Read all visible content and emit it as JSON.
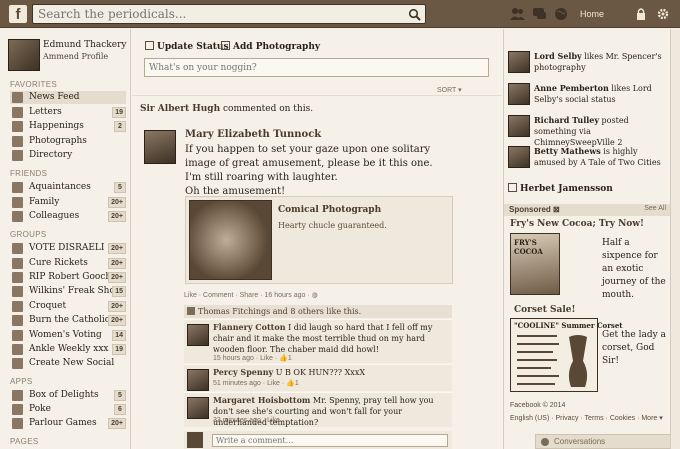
{
  "top": {
    "search_placeholder": "Search the periodicals...",
    "home": "Home"
  },
  "profile": {
    "name": "Edmund Thackery",
    "edit": "Ammend Profile"
  },
  "nav": {
    "favorites_label": "FAVORITES",
    "favorites": [
      {
        "label": "News Feed",
        "count": ""
      },
      {
        "label": "Letters",
        "count": "19"
      },
      {
        "label": "Happenings",
        "count": "2"
      },
      {
        "label": "Photographs",
        "count": ""
      },
      {
        "label": "Directory",
        "count": ""
      }
    ],
    "friends_label": "FRIENDS",
    "friends": [
      {
        "label": "Aquaintances",
        "count": "5"
      },
      {
        "label": "Family",
        "count": "20+"
      },
      {
        "label": "Colleagues",
        "count": "20+"
      }
    ],
    "groups_label": "GROUPS",
    "groups": [
      {
        "label": "VOTE DISRAELI",
        "count": "20+"
      },
      {
        "label": "Cure Rickets",
        "count": "20+"
      },
      {
        "label": "RIP Robert Gooch",
        "count": "20+"
      },
      {
        "label": "Wilkins' Freak Show",
        "count": "15"
      },
      {
        "label": "Croquet",
        "count": "20+"
      },
      {
        "label": "Burn the Catholics",
        "count": "20+"
      },
      {
        "label": "Women's Voting",
        "count": "14"
      },
      {
        "label": "Ankle Weekly xxx",
        "count": "19"
      },
      {
        "label": "Create New Social",
        "count": ""
      }
    ],
    "apps_label": "APPS",
    "apps": [
      {
        "label": "Box of Delights",
        "count": "5"
      },
      {
        "label": "Poke",
        "count": "6"
      },
      {
        "label": "Parlour Games",
        "count": "20+"
      }
    ],
    "pages_label": "PAGES"
  },
  "composer": {
    "tab_status": "Update Status",
    "tab_photo": "Add Photography",
    "placeholder": "What's on your noggin?",
    "sort": "SORT ▾"
  },
  "story": {
    "actor": "Sir Albert Hugh",
    "action": " commented on this.",
    "author": "Mary Elizabeth Tunnock",
    "text": "If you happen to set your gaze upon one solitary image of great amusement, please be it this one. I'm still roaring with laughter.",
    "text2": "Oh the amusement!",
    "attachment_title": "Comical Photograph",
    "attachment_desc": "Hearty chucle guaranteed.",
    "actions": "Like · Comment · Share · 16 hours ago · ◍",
    "likes": "Thomas Fitchings and 8 others like this.",
    "comments": [
      {
        "author": "Flannery Cotton",
        "text": " I did laugh so hard that I fell off my chair and it make the most terrible thud on my hard wooden floor. The chaber maid did howl!",
        "meta": "15 hours ago · Like · 👍1"
      },
      {
        "author": "Percy Spenny",
        "text": " U B OK HUN??? XxxX",
        "meta": "51 minutes ago · Like · 👍1"
      },
      {
        "author": "Margaret Hoisbottom",
        "text": " Mr. Spenny, pray tell how you don't see she's courting and won't fall for your underhanded temptation?",
        "meta": "33 minutes ago · Like"
      }
    ],
    "write_placeholder": "Write a comment..."
  },
  "ticker": [
    {
      "name": "Lord Selby",
      "text": " likes Mr. Spencer's photography"
    },
    {
      "name": "Anne Pemberton",
      "text": " likes Lord Selby's social status"
    },
    {
      "name": "Richard Tulley",
      "text": " posted something via ChimneySweepVille 2"
    },
    {
      "name": "Betty Mathews",
      "text": " is highly amused by A Tale of Two Cities"
    }
  ],
  "right": {
    "herbert": "Herbet Jamensson",
    "sponsored": "Sponsored ⊠",
    "see_all": "See All",
    "ad1_title": "Fry's New Cocoa; Try Now!",
    "ad1_text": "Half a sixpence for an exotic journey of the mouth.",
    "ad1_img_text": "FRY'S COCOA",
    "ad2_title": "Corset Sale!",
    "ad2_text": "Get the lady a corset, God Sir!",
    "ad2_img_text": "\"COOLINE\" Summer Corset",
    "footer1": "Facebook © 2014",
    "footer2": "English (US) · Privacy · Terms · Cookies · More ▾",
    "conversations": "Conversations"
  },
  "colors": {
    "topbar": "#6b5844",
    "page": "#f6f1e8",
    "accent": "#4a3a2a"
  }
}
